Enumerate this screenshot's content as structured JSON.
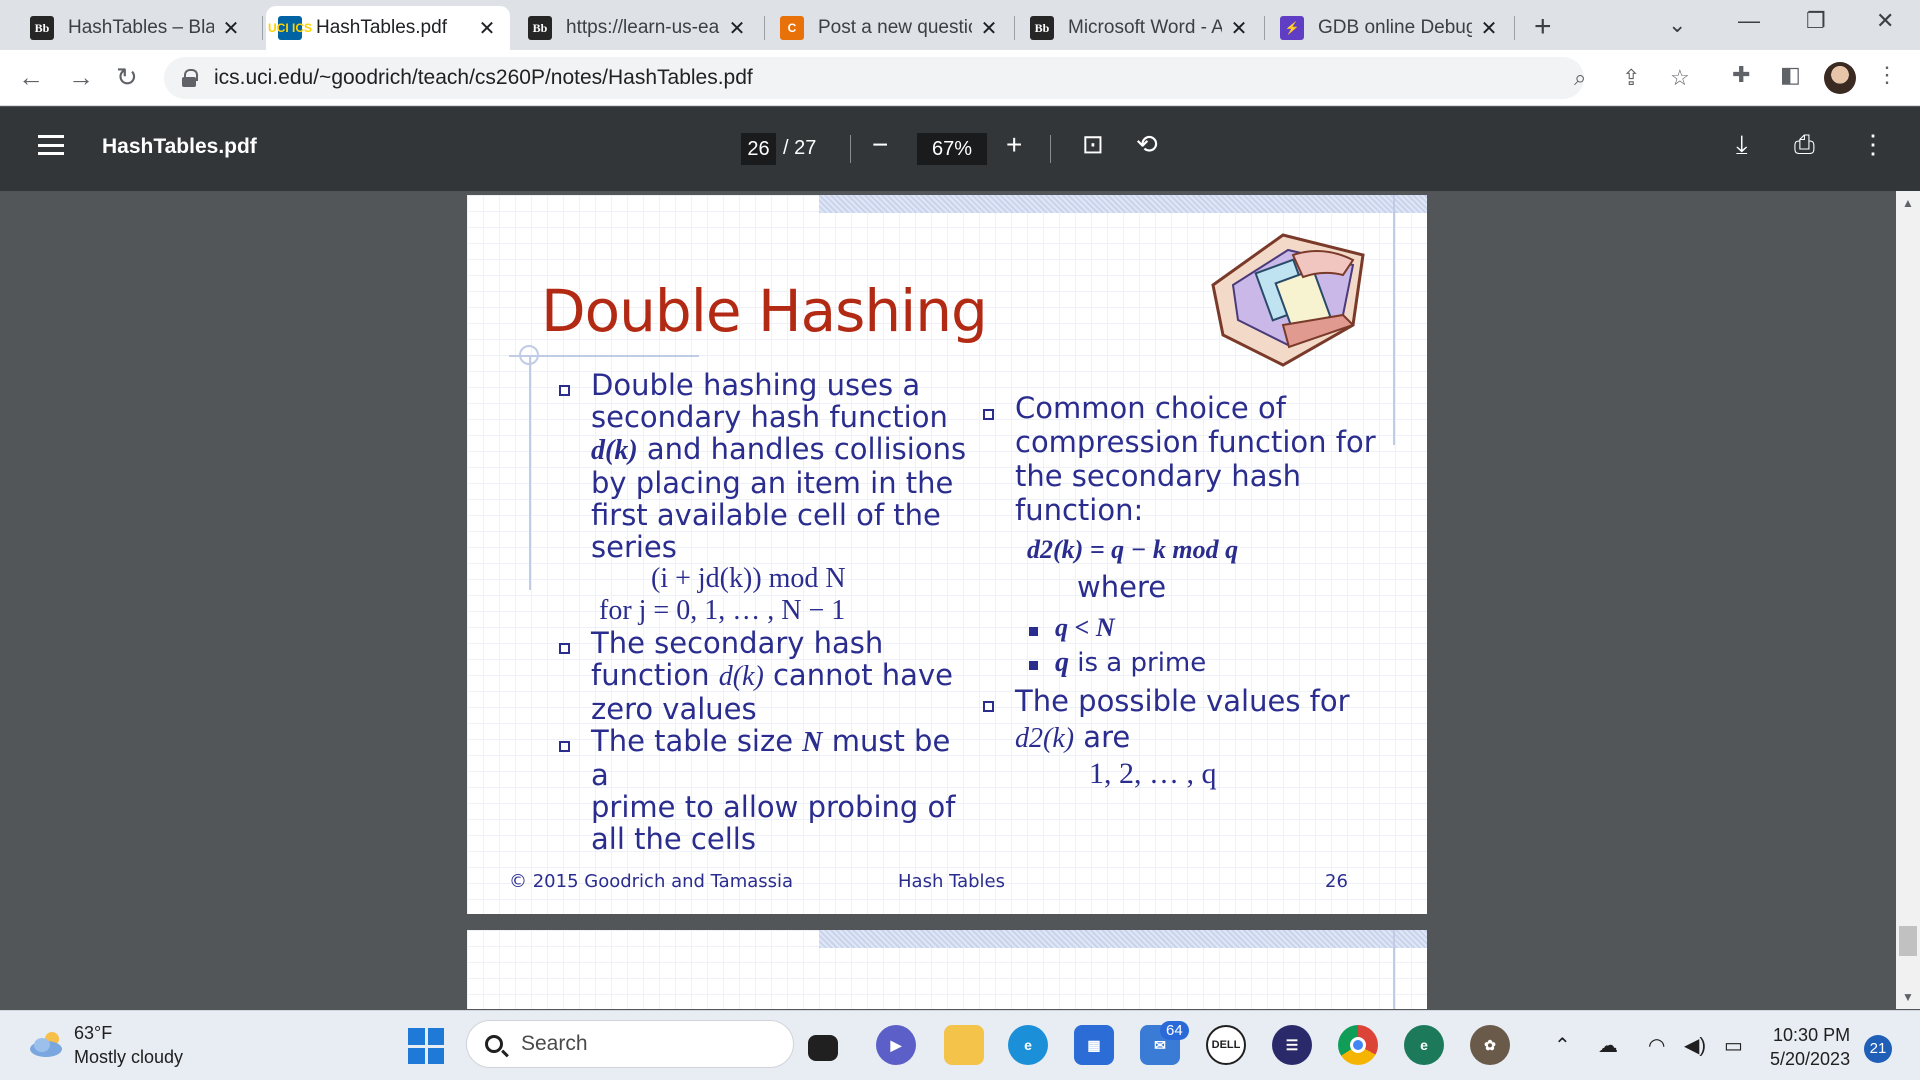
{
  "browser": {
    "tabs": [
      {
        "title": "HashTables – Blackb",
        "favicon": "Bb"
      },
      {
        "title": "HashTables.pdf",
        "favicon": "UCI ICS",
        "active": true
      },
      {
        "title": "https://learn-us-ea",
        "favicon": "Bb"
      },
      {
        "title": "Post a new question",
        "favicon": "C"
      },
      {
        "title": "Microsoft Word - A",
        "favicon": "Bb"
      },
      {
        "title": "GDB online Debugg",
        "favicon": "⚡"
      }
    ],
    "url": "ics.uci.edu/~goodrich/teach/cs260P/notes/HashTables.pdf"
  },
  "pdf": {
    "filename": "HashTables.pdf",
    "current_page": "26",
    "total_pages": "/ 27",
    "zoom": "67%"
  },
  "slide": {
    "title": "Double Hashing",
    "left": {
      "b1": [
        "Double hashing uses a",
        "secondary hash function",
        "and handles collisions",
        "by placing an item in the",
        "first available cell of the",
        "series"
      ],
      "b1_dk": "d(k)",
      "formula1": "(i + jd(k)) mod N",
      "formula2": "for j = 0,  1, … , N − 1",
      "b2": [
        "The secondary hash",
        "function",
        "cannot have",
        "zero values"
      ],
      "b2_dk": "d(k)",
      "b3": [
        "The table size",
        "must be a",
        "prime to allow probing of",
        "all the cells"
      ],
      "b3_N": "N"
    },
    "right": {
      "b1": [
        "Common choice of",
        "compression function for",
        "the secondary hash",
        "function:"
      ],
      "formula": "d2(k) = q − k mod q",
      "where": "where",
      "sub1": "q < N",
      "sub2_q": "q",
      "sub2_text": "is a prime",
      "b2": [
        "The possible values for",
        "are"
      ],
      "b2_d2k": "d2(k)",
      "values": "1, 2, … , q"
    },
    "footer": {
      "copyright": "© 2015 Goodrich and Tamassia",
      "topic": "Hash Tables",
      "page": "26"
    }
  },
  "taskbar": {
    "temp": "63°F",
    "weather": "Mostly cloudy",
    "search_placeholder": "Search",
    "mail_badge": "64",
    "time": "10:30 PM",
    "date": "5/20/2023",
    "notifications": "21"
  }
}
